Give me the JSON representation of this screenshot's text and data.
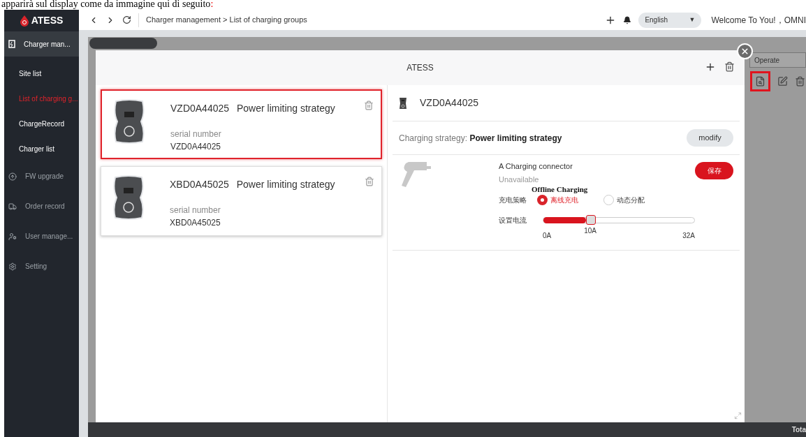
{
  "document_line": {
    "text": "apparirà sul display come da immagine qui di seguito",
    "mark": ":"
  },
  "sidebar": {
    "logo": "ATESS",
    "items": [
      {
        "kind": "group",
        "label": "Charger man...",
        "selected": true
      },
      {
        "kind": "sub",
        "label": "Site list",
        "selected": false
      },
      {
        "kind": "sub",
        "label": "List of charging g...",
        "selected": true
      },
      {
        "kind": "sub",
        "label": "ChargeRecord",
        "selected": false
      },
      {
        "kind": "sub",
        "label": "Charger list",
        "selected": false
      },
      {
        "kind": "group",
        "label": "FW upgrade",
        "selected": false
      },
      {
        "kind": "group",
        "label": "Order record",
        "selected": false
      },
      {
        "kind": "group",
        "label": "User manage...",
        "selected": false
      },
      {
        "kind": "group",
        "label": "Setting",
        "selected": false
      }
    ]
  },
  "topbar": {
    "breadcrumb": "Charger management > List of charging groups",
    "language": "English",
    "language_caret": "▼",
    "welcome": "Welcome To You!，OMNI"
  },
  "background_table": {
    "column": "Operate",
    "footer": "Tota"
  },
  "modal": {
    "title": "ATESS",
    "chargers": [
      {
        "serial": "VZD0A44025",
        "strategy": "Power limiting strategy",
        "serial_label": "serial number",
        "serial_value": "VZD0A44025",
        "selected": true
      },
      {
        "serial": "XBD0A45025",
        "strategy": "Power limiting strategy",
        "serial_label": "serial number",
        "serial_value": "XBD0A45025",
        "selected": false
      }
    ],
    "detail": {
      "serial": "VZD0A44025",
      "strategy_label": "Charging strategy:",
      "strategy_value": "Power limiting strategy",
      "modify": "modify",
      "connector": {
        "name": "A Charging connector",
        "status": "Unavailable",
        "annotation": "Offline Charging",
        "save": "保存",
        "strategy_label": "充电策略",
        "options": [
          {
            "label": "离线充电",
            "selected": true
          },
          {
            "label": "动态分配",
            "selected": false
          }
        ],
        "current_label": "设置电流",
        "level": 0.3125,
        "min": "0A",
        "value": "10A",
        "max": "32A"
      }
    }
  }
}
